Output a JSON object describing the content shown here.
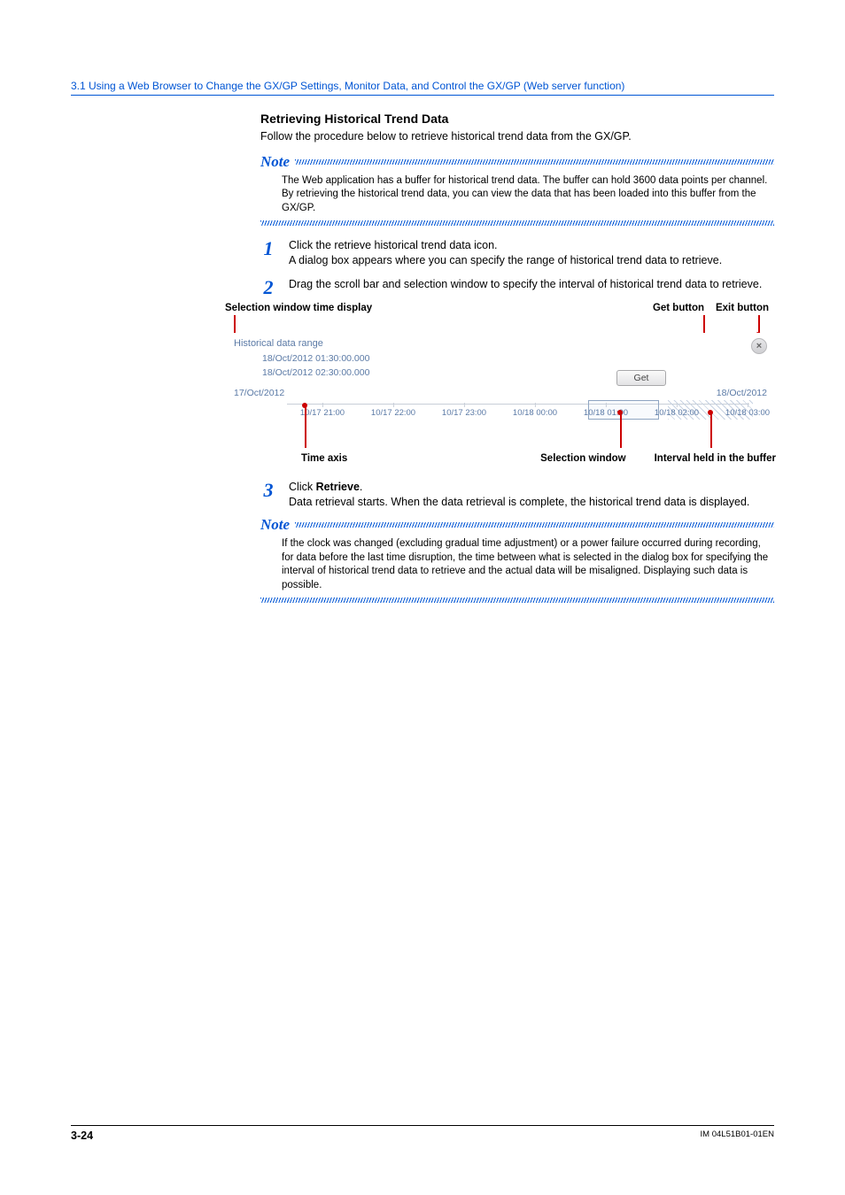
{
  "breadcrumb": "3.1  Using a Web Browser to Change the GX/GP Settings, Monitor Data, and Control the GX/GP (Web server function)",
  "section_title": "Retrieving Historical Trend Data",
  "intro": "Follow the procedure below to retrieve historical trend data from the GX/GP.",
  "note_label": "Note",
  "note1": "The Web application has a buffer for historical trend data. The buffer can hold 3600 data points per channel. By retrieving the historical trend data, you can view the data that has been loaded into this buffer from the GX/GP.",
  "steps": {
    "s1": {
      "num": "1",
      "l1": "Click the retrieve historical trend data icon.",
      "l2": "A dialog box appears where you can specify the range of historical trend data to retrieve."
    },
    "s2": {
      "num": "2",
      "l1": "Drag the scroll bar and selection window to specify the interval of historical trend data to retrieve."
    },
    "s3": {
      "num": "3",
      "l1a": "Click ",
      "l1b": "Retrieve",
      "l1c": ".",
      "l2": "Data retrieval starts. When the data retrieval is complete, the historical trend data is displayed."
    }
  },
  "callouts": {
    "sel_time": "Selection window time display",
    "get": "Get button",
    "exit": "Exit button",
    "time_axis": "Time axis",
    "sel_window": "Selection window",
    "interval": "Interval held in the buffer"
  },
  "dialog": {
    "title": "Historical data range",
    "from": "18/Oct/2012 01:30:00.000",
    "to": "18/Oct/2012 02:30:00.000",
    "get_label": "Get",
    "close_glyph": "×",
    "axis_start": "17/Oct/2012",
    "axis_end": "18/Oct/2012",
    "ticks": [
      "10/17 21:00",
      "10/17 22:00",
      "10/17 23:00",
      "10/18 00:00",
      "10/18 01:00",
      "10/18 02:00",
      "10/18 03:00"
    ]
  },
  "note2": "If the clock was changed (excluding gradual time adjustment) or a power failure occurred during recording, for data before the last time disruption, the time between what is selected in the dialog box for specifying the interval of historical trend data to retrieve and the actual data will be misaligned. Displaying such data is possible.",
  "footer": {
    "page": "3-24",
    "docid": "IM 04L51B01-01EN"
  }
}
